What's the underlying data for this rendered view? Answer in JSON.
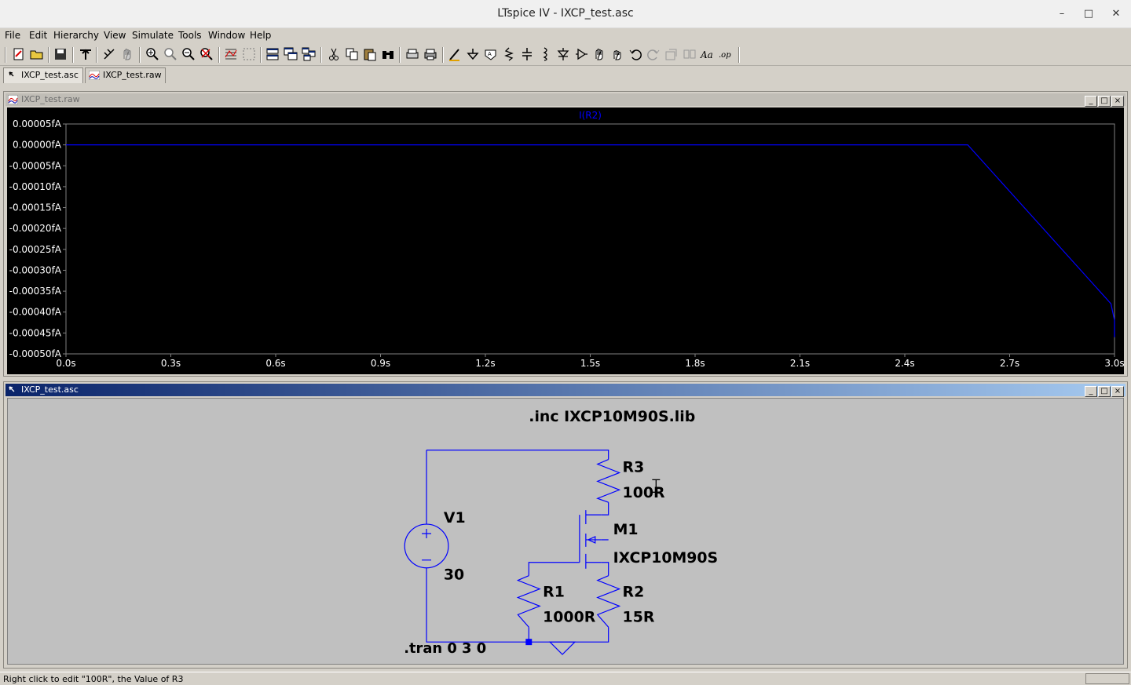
{
  "window": {
    "title": "LTspice IV - IXCP_test.asc"
  },
  "menu": [
    "File",
    "Edit",
    "Hierarchy",
    "View",
    "Simulate",
    "Tools",
    "Window",
    "Help"
  ],
  "tabs": [
    {
      "label": "IXCP_test.asc",
      "active": true
    },
    {
      "label": "IXCP_test.raw",
      "active": false
    }
  ],
  "waveform_window": {
    "title": "IXCP_test.raw"
  },
  "schematic_window": {
    "title": "IXCP_test.asc"
  },
  "chart_data": {
    "type": "line",
    "trace_label": "I(R2)",
    "y_ticks": [
      "0.00005fA",
      "0.00000fA",
      "-0.00005fA",
      "-0.00010fA",
      "-0.00015fA",
      "-0.00020fA",
      "-0.00025fA",
      "-0.00030fA",
      "-0.00035fA",
      "-0.00040fA",
      "-0.00045fA",
      "-0.00050fA"
    ],
    "x_ticks": [
      "0.0s",
      "0.3s",
      "0.6s",
      "0.9s",
      "1.2s",
      "1.5s",
      "1.8s",
      "2.1s",
      "2.4s",
      "2.7s",
      "3.0s"
    ],
    "xlim": [
      0,
      3.0
    ],
    "ylim": [
      -0.0005,
      5e-05
    ],
    "series": [
      {
        "x": [
          0,
          2.58,
          2.99,
          3.0,
          3.0
        ],
        "y": [
          0,
          0,
          -0.00038,
          -0.00042,
          -0.00046
        ]
      }
    ],
    "colors": {
      "background": "#000000",
      "axis": "#808080",
      "trace": "#0000ff",
      "tick_text": "#ffffff",
      "title": "#0000ff"
    }
  },
  "schematic": {
    "directive_inc": ".inc IXCP10M90S.lib",
    "directive_tran": ".tran 0 3 0",
    "V1": {
      "name": "V1",
      "value": "30"
    },
    "R3": {
      "name": "R3",
      "value": "100R"
    },
    "M1": {
      "name": "M1",
      "model": "IXCP10M90S"
    },
    "R1": {
      "name": "R1",
      "value": "1000R"
    },
    "R2": {
      "name": "R2",
      "value": "15R"
    },
    "colors": {
      "wire": "#0000ff",
      "background": "#c0c0c0",
      "text": "#000000"
    }
  },
  "status": {
    "text": "Right click to edit \"100R\", the Value of R3"
  }
}
